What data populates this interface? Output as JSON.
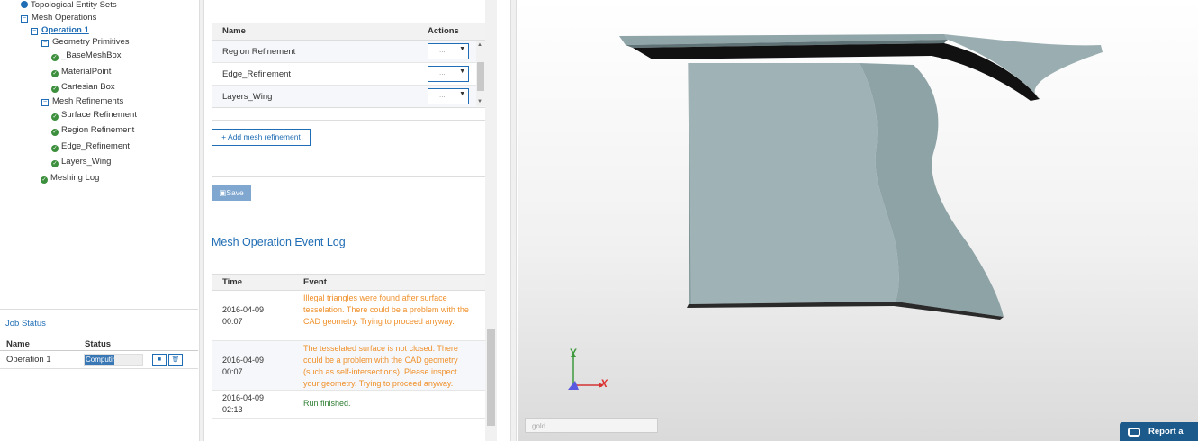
{
  "tree": {
    "topological_entity_sets": "Topological Entity Sets",
    "mesh_operations": "Mesh Operations",
    "operation_1": "Operation 1",
    "geometry_primitives": "Geometry Primitives",
    "primitives": [
      "_BaseMeshBox",
      "MaterialPoint",
      "Cartesian Box"
    ],
    "mesh_refinements": "Mesh Refinements",
    "refinements": [
      "Surface Refinement",
      "Region Refinement",
      "Edge_Refinement",
      "Layers_Wing"
    ],
    "meshing_log": "Meshing Log"
  },
  "job_status": {
    "title": "Job Status",
    "headers": {
      "name": "Name",
      "status": "Status"
    },
    "rows": [
      {
        "name": "Operation 1",
        "status": "Computing",
        "progress": 0.5
      }
    ]
  },
  "refinements_table": {
    "headers": {
      "name": "Name",
      "actions": "Actions"
    },
    "rows": [
      {
        "name": "Region Refinement",
        "action": "..."
      },
      {
        "name": "Edge_Refinement",
        "action": "..."
      },
      {
        "name": "Layers_Wing",
        "action": "..."
      }
    ]
  },
  "buttons": {
    "add_refinement": "Add mesh refinement",
    "save": "Save"
  },
  "event_log": {
    "title": "Mesh Operation Event Log",
    "headers": {
      "time": "Time",
      "event": "Event"
    },
    "rows": [
      {
        "time_date": "2016-04-09",
        "time_clock": "00:07",
        "event": "Illegal triangles were found after surface tesselation. There could be a problem with the CAD geometry. Trying to proceed anyway.",
        "level": "warning"
      },
      {
        "time_date": "2016-04-09",
        "time_clock": "00:07",
        "event": "The tesselated surface is not closed. There could be a problem with the CAD geometry (such as self-intersections). Please inspect your geometry. Trying to proceed anyway.",
        "level": "warning"
      },
      {
        "time_date": "2016-04-09",
        "time_clock": "02:13",
        "event": "Run finished.",
        "level": "success"
      }
    ]
  },
  "viewport": {
    "axis_y": "Y",
    "axis_x": "X",
    "color_input_value": "gold",
    "report_bug": "Report a bug",
    "colors": {
      "model": "#9fb3b6",
      "axis_y": "#3c9a3c",
      "axis_x": "#d33333",
      "axis_z": "#5a5ae0"
    }
  }
}
